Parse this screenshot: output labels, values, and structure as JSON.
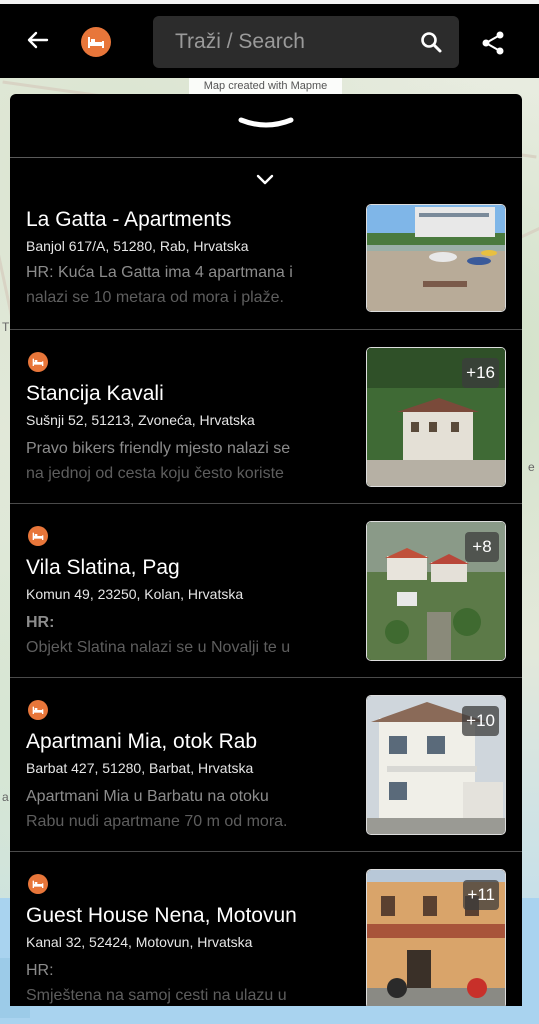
{
  "topbar": {
    "search_placeholder": "Traži / Search"
  },
  "map": {
    "credit": "Map created with Mapme"
  },
  "colors": {
    "accent": "#e8763a",
    "panel": "#000000",
    "topbar": "#000000"
  },
  "icons": [
    "back-arrow-icon",
    "bed-icon",
    "search-icon",
    "share-icon",
    "chevron-down-icon"
  ],
  "listings": [
    {
      "title": "La Gatta - Apartments",
      "address": "Banjol 617/A, 51280, Rab, Hrvatska",
      "desc_line1": "HR: Kuća La Gatta ima 4 apartmana i",
      "desc_line2": "nalazi se 10 metara od mora i plaže.",
      "photo_count": ""
    },
    {
      "title": "Stancija Kavali",
      "address": "Sušnji 52, 51213, Zvoneća, Hrvatska",
      "desc_line1": "Pravo bikers friendly mjesto nalazi se",
      "desc_line2": "na jednoj od cesta koju često koriste",
      "photo_count": "+16"
    },
    {
      "title": "Vila Slatina, Pag",
      "address": "Komun 49, 23250, Kolan, Hrvatska",
      "desc_line1": "HR:",
      "desc_line2": "Objekt Slatina nalazi se u Novalji te u",
      "photo_count": "+8"
    },
    {
      "title": "Apartmani Mia, otok Rab",
      "address": "Barbat 427, 51280, Barbat, Hrvatska",
      "desc_line1": "Apartmani Mia u Barbatu na otoku",
      "desc_line2": "Rabu nudi apartmane 70 m od mora.",
      "photo_count": "+10"
    },
    {
      "title": "Guest House Nena, Motovun",
      "address": "Kanal 32, 52424, Motovun, Hrvatska",
      "desc_line1": "HR:",
      "desc_line2": "Smještena na samoj cesti na ulazu u",
      "photo_count": "+11"
    }
  ]
}
